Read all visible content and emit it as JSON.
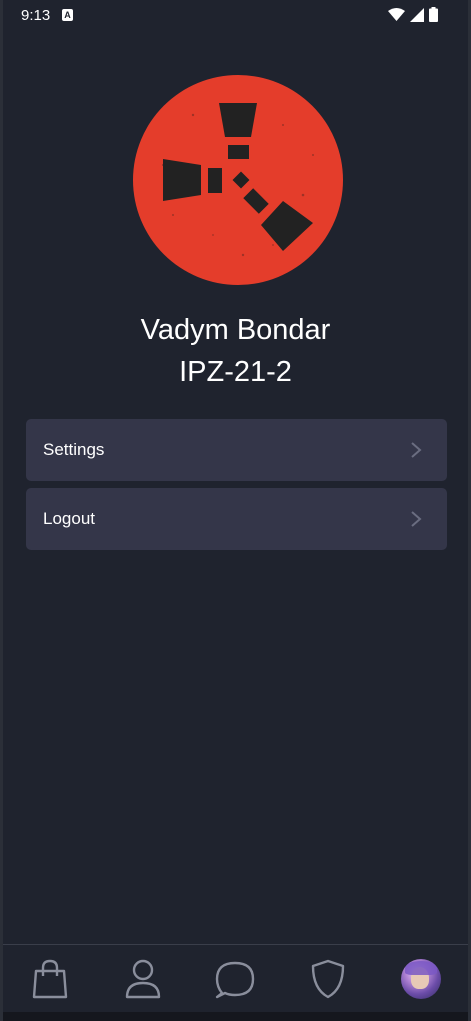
{
  "status_bar": {
    "time": "9:13",
    "notification_glyph": "A"
  },
  "profile": {
    "name": "Vadym Bondar",
    "group": "IPZ-21-2",
    "logo_color": "#e43d2b"
  },
  "menu": {
    "settings_label": "Settings",
    "logout_label": "Logout"
  },
  "bottom_nav": {
    "items": [
      "shopping-bag-icon",
      "person-icon",
      "chat-bubble-icon",
      "shield-icon",
      "user-avatar"
    ]
  }
}
